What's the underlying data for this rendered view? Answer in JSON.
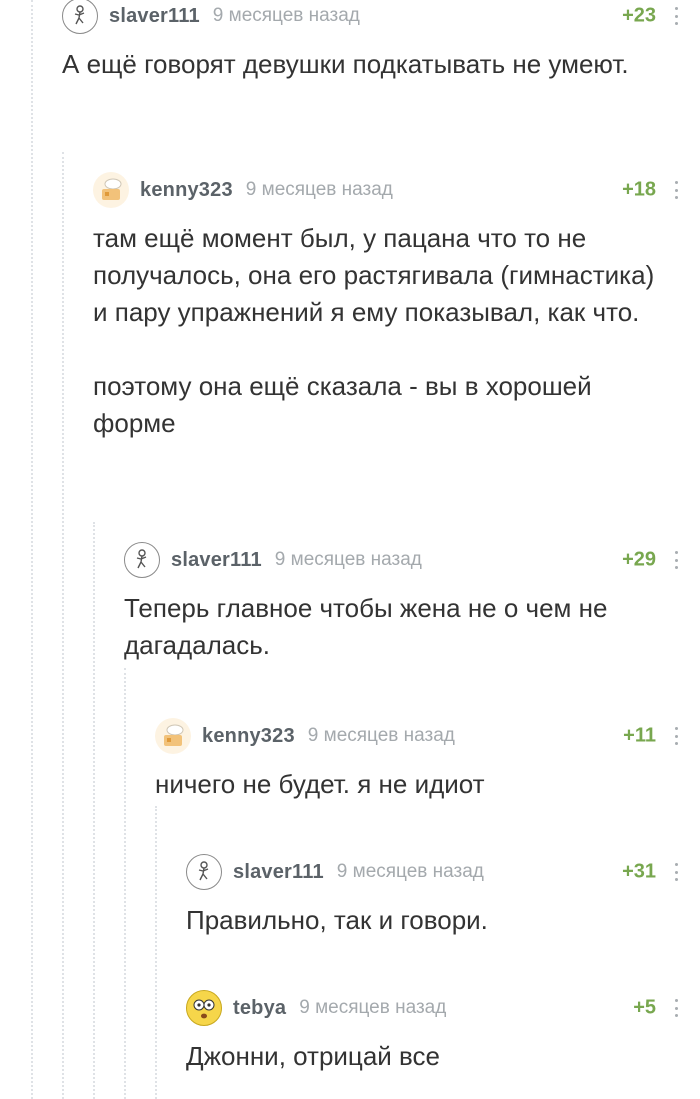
{
  "comments": [
    {
      "username": "slaver111",
      "time": "9 месяцев назад",
      "rating": "+23",
      "text": "А ещё говорят девушки подкатывать не умеют.",
      "avatar_icon": "sketch-figure-avatar"
    },
    {
      "username": "kenny323",
      "time": "9 месяцев назад",
      "rating": "+18",
      "text": "там ещё момент был,  у пацана что то не получалось, она его растягивала (гимнастика) и пару упражнений я ему показывал, как что.\n\nпоэтому она ещё сказала - вы в хорошей форме",
      "avatar_icon": "chef-hat-avatar"
    },
    {
      "username": "slaver111",
      "time": "9 месяцев назад",
      "rating": "+29",
      "text": "Теперь главное чтобы жена не о чем не дагадалась.",
      "avatar_icon": "sketch-figure-avatar"
    },
    {
      "username": "kenny323",
      "time": "9 месяцев назад",
      "rating": "+11",
      "text": "ничего не будет. я не идиот",
      "avatar_icon": "chef-hat-avatar"
    },
    {
      "username": "slaver111",
      "time": "9 месяцев назад",
      "rating": "+31",
      "text": "Правильно, так и говори.",
      "avatar_icon": "sketch-figure-avatar"
    },
    {
      "username": "tebya",
      "time": "9 месяцев назад",
      "rating": "+5",
      "text": "Джонни, отрицай все",
      "avatar_icon": "surprised-face-avatar"
    }
  ],
  "colors": {
    "rating": "#78a74f",
    "username": "#5b6268",
    "time": "#a4a9ad",
    "thread_line": "#dfe2e6"
  }
}
